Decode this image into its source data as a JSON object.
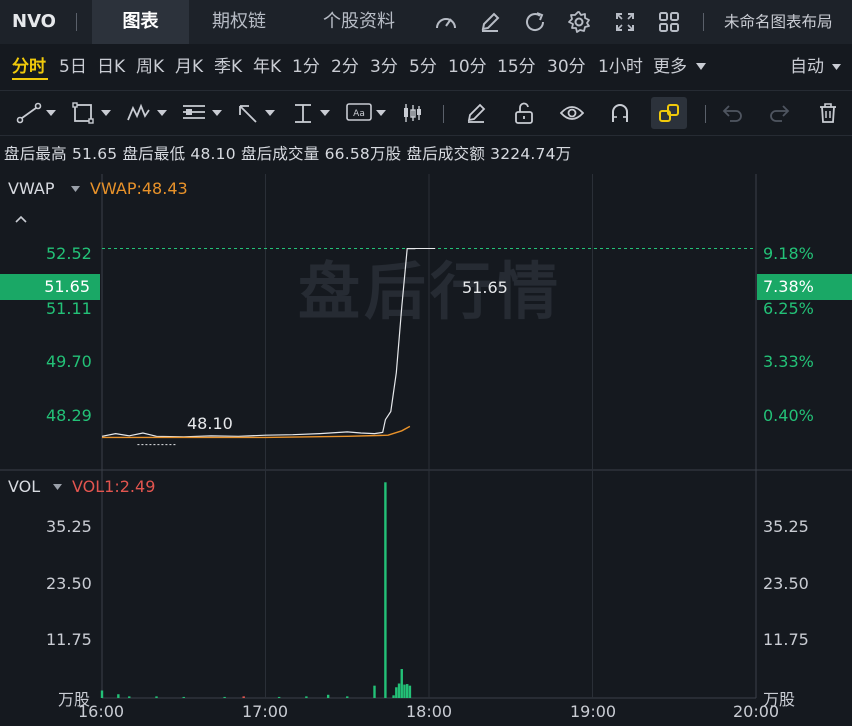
{
  "header": {
    "symbol": "NVO",
    "tabs": [
      "图表",
      "期权链",
      "个股资料"
    ],
    "active_tab": 0,
    "layout_name": "未命名图表布局"
  },
  "periods": {
    "items": [
      "分时",
      "5日",
      "日K",
      "周K",
      "月K",
      "季K",
      "年K",
      "1分",
      "2分",
      "3分",
      "5分",
      "10分",
      "15分",
      "30分",
      "1小时",
      "更多"
    ],
    "active": 0,
    "mode": "自动"
  },
  "after_hours": {
    "high_label": "盘后最高",
    "high": "51.65",
    "low_label": "盘后最低",
    "low": "48.10",
    "volume_label": "盘后成交量",
    "volume": "66.58万股",
    "turnover_label": "盘后成交额",
    "turnover": "3224.74万"
  },
  "price_panel": {
    "indicator": "VWAP",
    "indicator_value": "VWAP:48.43",
    "watermark": "盘后行情",
    "left_ticks": [
      "52.52",
      "51.11",
      "49.70",
      "48.29"
    ],
    "right_ticks": [
      "9.18%",
      "6.25%",
      "3.33%",
      "0.40%"
    ],
    "current_price": "51.65",
    "current_pct": "7.38%",
    "high_label": "51.65",
    "low_label": "48.10"
  },
  "volume_panel": {
    "indicator": "VOL",
    "indicator_value": "VOL1:2.49",
    "left_ticks": [
      "35.25",
      "23.50",
      "11.75"
    ],
    "right_ticks": [
      "35.25",
      "23.50",
      "11.75"
    ],
    "unit": "万股"
  },
  "time_axis": [
    "16:00",
    "17:00",
    "18:00",
    "19:00",
    "20:00"
  ],
  "colors": {
    "up": "#23c177",
    "down": "#e2554f",
    "accent": "#f0c90b",
    "vwap": "#e8922a",
    "price_line": "#e6e8eb"
  },
  "chart_data": {
    "type": "line",
    "x_range": [
      "16:00",
      "20:00"
    ],
    "y_range": [
      47.64,
      53.0
    ],
    "series": [
      {
        "name": "VWAP",
        "points": [
          [
            "16:00",
            48.23
          ],
          [
            "16:30",
            48.23
          ],
          [
            "17:00",
            48.23
          ],
          [
            "17:30",
            48.25
          ],
          [
            "17:45",
            48.27
          ],
          [
            "17:50",
            48.35
          ],
          [
            "17:53",
            48.43
          ]
        ]
      }
    ],
    "price_points": [
      [
        "16:00",
        48.25
      ],
      [
        "16:05",
        48.3
      ],
      [
        "16:10",
        48.26
      ],
      [
        "16:15",
        48.31
      ],
      [
        "16:20",
        48.25
      ],
      [
        "16:30",
        48.24
      ],
      [
        "16:40",
        48.26
      ],
      [
        "16:50",
        48.25
      ],
      [
        "17:00",
        48.27
      ],
      [
        "17:10",
        48.28
      ],
      [
        "17:20",
        48.3
      ],
      [
        "17:30",
        48.33
      ],
      [
        "17:35",
        48.31
      ],
      [
        "17:40",
        48.3
      ],
      [
        "17:43",
        48.32
      ],
      [
        "17:44",
        48.55
      ],
      [
        "17:46",
        48.7
      ],
      [
        "17:48",
        49.4
      ],
      [
        "17:50",
        50.6
      ],
      [
        "17:52",
        51.65
      ],
      [
        "17:55",
        51.65
      ]
    ],
    "volume": {
      "y_range": [
        0,
        41
      ],
      "bars": [
        [
          "16:00",
          1.4,
          "up"
        ],
        [
          "16:06",
          0.7,
          "up"
        ],
        [
          "16:10",
          0.3,
          "up"
        ],
        [
          "16:20",
          0.3,
          "up"
        ],
        [
          "16:30",
          0.2,
          "up"
        ],
        [
          "16:45",
          0.2,
          "up"
        ],
        [
          "16:52",
          0.3,
          "down"
        ],
        [
          "17:05",
          0.2,
          "up"
        ],
        [
          "17:15",
          0.3,
          "up"
        ],
        [
          "17:23",
          0.6,
          "up"
        ],
        [
          "17:30",
          0.3,
          "up"
        ],
        [
          "17:40",
          2.3,
          "up"
        ],
        [
          "17:44",
          40.2,
          "up"
        ],
        [
          "17:47",
          0.5,
          "up"
        ],
        [
          "17:48",
          2.0,
          "up"
        ],
        [
          "17:49",
          2.7,
          "up"
        ],
        [
          "17:50",
          5.4,
          "up"
        ],
        [
          "17:51",
          2.5,
          "up"
        ],
        [
          "17:52",
          2.6,
          "up"
        ],
        [
          "17:53",
          2.3,
          "up"
        ]
      ]
    }
  }
}
